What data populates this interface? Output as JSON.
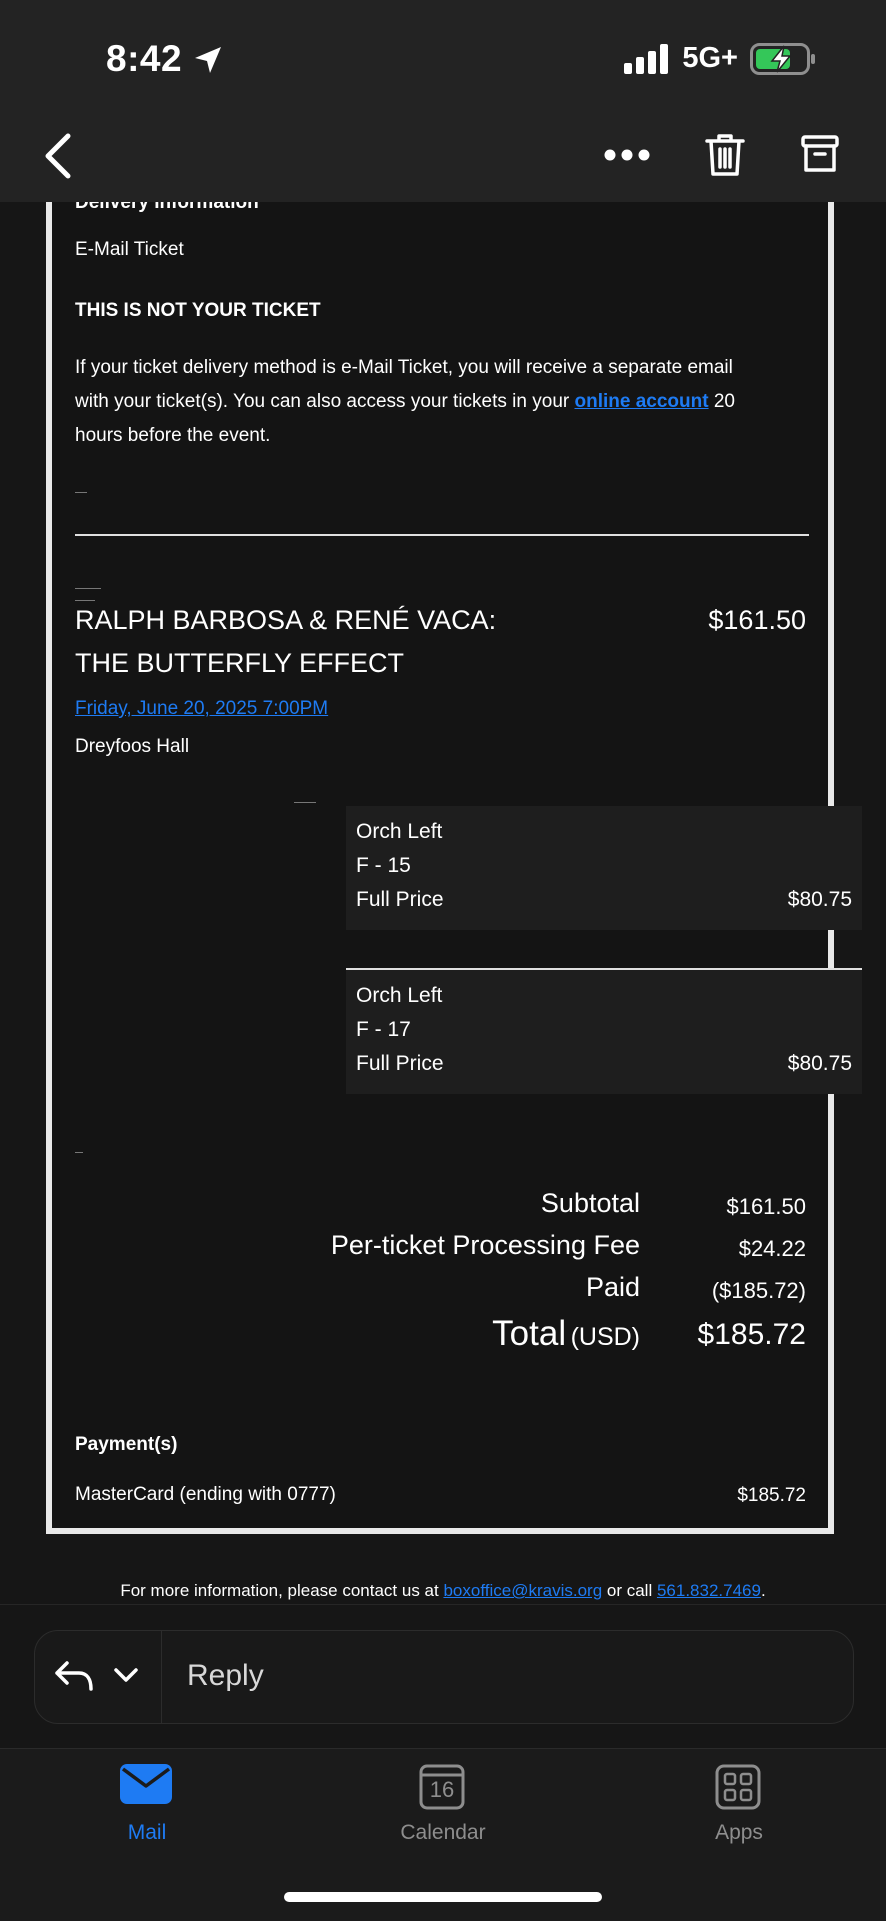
{
  "status_bar": {
    "time": "8:42",
    "network": "5G+"
  },
  "email": {
    "delivery_heading": "Delivery Information",
    "delivery_method": "E-Mail Ticket",
    "not_ticket_heading": "THIS IS NOT YOUR TICKET",
    "notice_line1": "If your ticket delivery method is e-Mail Ticket, you will receive a separate email",
    "notice_line2_pre": "with your ticket(s).  You can also access your tickets in your ",
    "notice_link": "online account",
    "notice_line2_post": " 20",
    "notice_line3": "hours before the event.",
    "event": {
      "title_line1": "RALPH BARBOSA & RENÉ VACA:",
      "title_line2": "THE BUTTERFLY EFFECT",
      "price": "$161.50",
      "datetime": "Friday, June 20, 2025 7:00PM",
      "venue": "Dreyfoos Hall"
    },
    "seats": [
      {
        "section": "Orch Left",
        "seat": "F - 15",
        "price_type": "Full Price",
        "price": "$80.75"
      },
      {
        "section": "Orch Left",
        "seat": "F - 17",
        "price_type": "Full Price",
        "price": "$80.75"
      }
    ],
    "totals": {
      "subtotal_label": "Subtotal",
      "subtotal": "$161.50",
      "fee_label": "Per-ticket Processing Fee",
      "fee": "$24.22",
      "paid_label": "Paid",
      "paid": "($185.72)",
      "total_label": "Total",
      "total_currency": "(USD)",
      "total": "$185.72"
    },
    "payment": {
      "heading": "Payment(s)",
      "method": "MasterCard (ending with 0777)",
      "amount": "$185.72"
    },
    "footer": {
      "pre": "For more information, please contact us at ",
      "email": "boxoffice@kravis.org",
      "mid": " or call ",
      "phone": "561.832.7469",
      "post": "."
    }
  },
  "reply": {
    "label": "Reply"
  },
  "tabs": [
    {
      "label": "Mail",
      "active": true
    },
    {
      "label": "Calendar",
      "date": "16"
    },
    {
      "label": "Apps"
    }
  ],
  "colors": {
    "accent": "#1e7bf3",
    "battery": "#34c759"
  }
}
